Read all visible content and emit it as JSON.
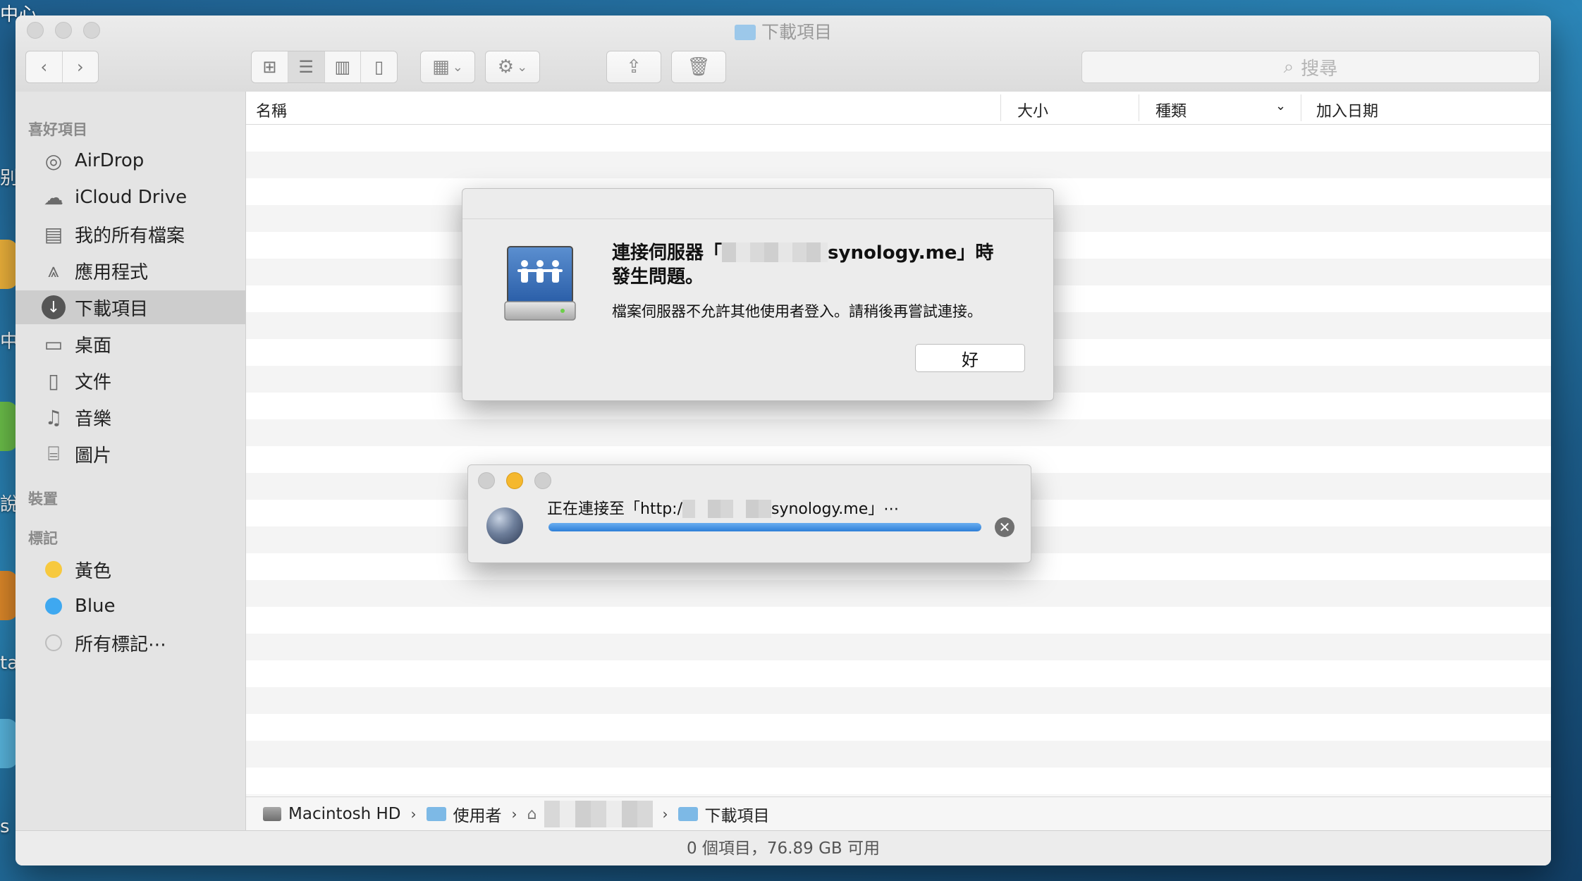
{
  "desktop": {
    "fragments": [
      "中心",
      "别",
      "中",
      "說",
      "ta",
      "s"
    ]
  },
  "window": {
    "title": "下載項目",
    "search_placeholder": "搜尋"
  },
  "sidebar": {
    "favorites_header": "喜好項目",
    "favorites": [
      {
        "label": "AirDrop",
        "icon": "airdrop-icon"
      },
      {
        "label": "iCloud Drive",
        "icon": "cloud-icon"
      },
      {
        "label": "我的所有檔案",
        "icon": "all-files-icon"
      },
      {
        "label": "應用程式",
        "icon": "applications-icon"
      },
      {
        "label": "下載項目",
        "icon": "download-icon",
        "selected": true
      },
      {
        "label": "桌面",
        "icon": "desktop-icon"
      },
      {
        "label": "文件",
        "icon": "documents-icon"
      },
      {
        "label": "音樂",
        "icon": "music-icon"
      },
      {
        "label": "圖片",
        "icon": "camera-icon"
      }
    ],
    "devices_header": "裝置",
    "tags_header": "標記",
    "tags": [
      {
        "label": "黃色",
        "color": "#f7c93e"
      },
      {
        "label": "Blue",
        "color": "#3ea8f0"
      },
      {
        "label": "所有標記⋯",
        "color": "#d0d0d0"
      }
    ]
  },
  "list": {
    "columns": [
      "名稱",
      "大小",
      "種類",
      "加入日期"
    ]
  },
  "pathbar": {
    "items": [
      "Macintosh HD",
      "使用者",
      "下載項目"
    ]
  },
  "status": "0 個項目，76.89 GB 可用",
  "alert": {
    "title_prefix": "連接伺服器「",
    "title_suffix": "synology.me」時發生問題。",
    "message": "檔案伺服器不允許其他使用者登入。請稍後再嘗試連接。",
    "ok_label": "好"
  },
  "progress_window": {
    "text_prefix": "正在連接至「http:/",
    "text_suffix": "synology.me」⋯",
    "progress": 1.0,
    "accent": "#2e7fd8"
  }
}
